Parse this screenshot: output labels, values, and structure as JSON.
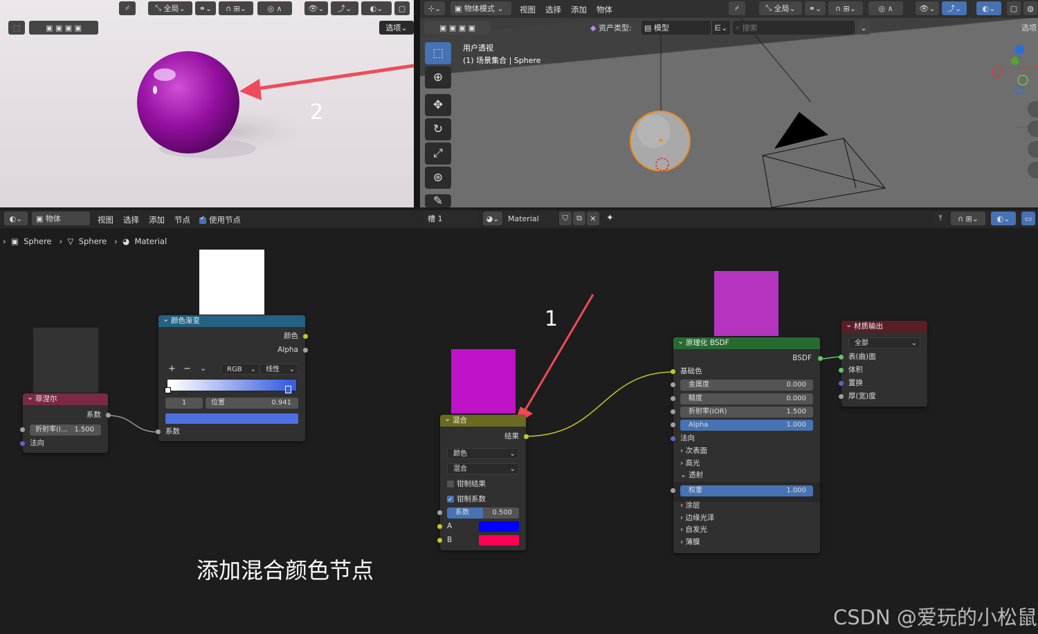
{
  "left_viewport": {
    "header": {
      "transform_label": "全局",
      "options_label": "选项"
    },
    "annotation_number": "2"
  },
  "right_viewport": {
    "header": {
      "mode_label": "物体模式",
      "menu": [
        "视图",
        "选择",
        "添加",
        "物体"
      ],
      "transform_label": "全局",
      "asset_type_label": "资产类型:",
      "asset_type_value": "模型",
      "search_placeholder": "搜索",
      "options_label": "选项"
    },
    "overlay_title": "用户透视",
    "overlay_subtitle": "(1) 场景集合 | Sphere"
  },
  "node_editor": {
    "header": {
      "type_label": "物体",
      "menu": [
        "视图",
        "选择",
        "添加",
        "节点"
      ],
      "use_nodes_label": "使用节点",
      "slot_label": "槽 1",
      "material_name": "Material"
    },
    "breadcrumb": [
      "Sphere",
      "Sphere",
      "Material"
    ],
    "annotation_number": "1",
    "caption": "添加混合颜色节点",
    "watermark": "CSDN @爱玩的小松鼠"
  },
  "nodes": {
    "fresnel": {
      "title": "菲涅尔",
      "out_label": "系数",
      "ior_label": "折射率(I...",
      "ior_value": "1.500",
      "normal_label": "法向"
    },
    "color_ramp": {
      "title": "颜色渐变",
      "out_color": "颜色",
      "out_alpha": "Alpha",
      "mode": "RGB",
      "interp": "线性",
      "stop_index": "1",
      "pos_label": "位置",
      "pos_value": "0.941",
      "in_fac": "系数"
    },
    "mix": {
      "title": "混合",
      "out_label": "结果",
      "data_type": "颜色",
      "blend": "混合",
      "clamp_result": "钳制结果",
      "clamp_factor": "钳制系数",
      "fac_label": "系数",
      "fac_value": "0.500",
      "a_label": "A",
      "b_label": "B"
    },
    "bsdf": {
      "title": "原理化 BSDF",
      "out_label": "BSDF",
      "base_color": "基础色",
      "metallic_label": "金属度",
      "metallic_value": "0.000",
      "roughness_label": "糙度",
      "roughness_value": "0.000",
      "ior_label": "折射率(IOR)",
      "ior_value": "1.500",
      "alpha_label": "Alpha",
      "alpha_value": "1.000",
      "normal": "法向",
      "subsurface": "次表面",
      "specular": "高光",
      "transmission": "透射",
      "weight_label": "权重",
      "weight_value": "1.000",
      "coat": "涂层",
      "sheen": "边缘光泽",
      "emission": "自发光",
      "thin_film": "薄膜"
    },
    "output": {
      "title": "材质输出",
      "target": "全部",
      "surface": "表(曲)面",
      "volume": "体积",
      "displacement": "置换",
      "thickness": "厚(宽)度"
    }
  },
  "colors": {
    "mix_preview": "#c012c8",
    "bsdf_preview": "#b535c0",
    "mix_a": "#0000ff",
    "mix_b": "#ff0055",
    "annotation": "#f04a5a"
  }
}
